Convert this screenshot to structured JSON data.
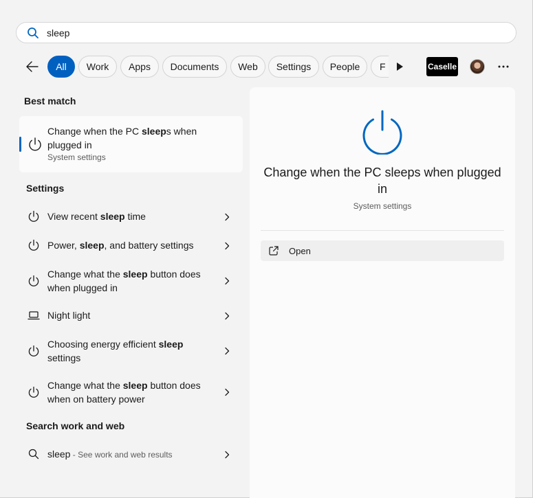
{
  "search": {
    "query": "sleep"
  },
  "filters": {
    "chips": [
      "All",
      "Work",
      "Apps",
      "Documents",
      "Web",
      "Settings",
      "People",
      "F"
    ],
    "org_label": "Caselle"
  },
  "best_match": {
    "section_title": "Best match",
    "title_pre": "Change when the PC ",
    "title_bold": "sleep",
    "title_post": "s when plugged in",
    "subtitle": "System settings"
  },
  "settings": {
    "section_title": "Settings",
    "items": [
      {
        "pre": "View recent ",
        "bold": "sleep",
        "post": " time",
        "icon": "power-icon"
      },
      {
        "pre": "Power, ",
        "bold": "sleep",
        "post": ", and battery settings",
        "icon": "power-icon"
      },
      {
        "pre": "Change what the ",
        "bold": "sleep",
        "post": " button does when plugged in",
        "icon": "power-icon"
      },
      {
        "pre": "Night light",
        "bold": "",
        "post": "",
        "icon": "laptop-icon"
      },
      {
        "pre": "Choosing energy efficient ",
        "bold": "sleep",
        "post": " settings",
        "icon": "power-icon"
      },
      {
        "pre": "Change what the ",
        "bold": "sleep",
        "post": " button does when on battery power",
        "icon": "power-icon"
      }
    ]
  },
  "web": {
    "section_title": "Search work and web",
    "query": "sleep",
    "hint": " - See work and web results"
  },
  "detail": {
    "title": "Change when the PC sleeps when plugged in",
    "subtitle": "System settings",
    "open_label": "Open"
  },
  "colors": {
    "accent": "#0067c0",
    "chip_active": "#0060c0"
  }
}
